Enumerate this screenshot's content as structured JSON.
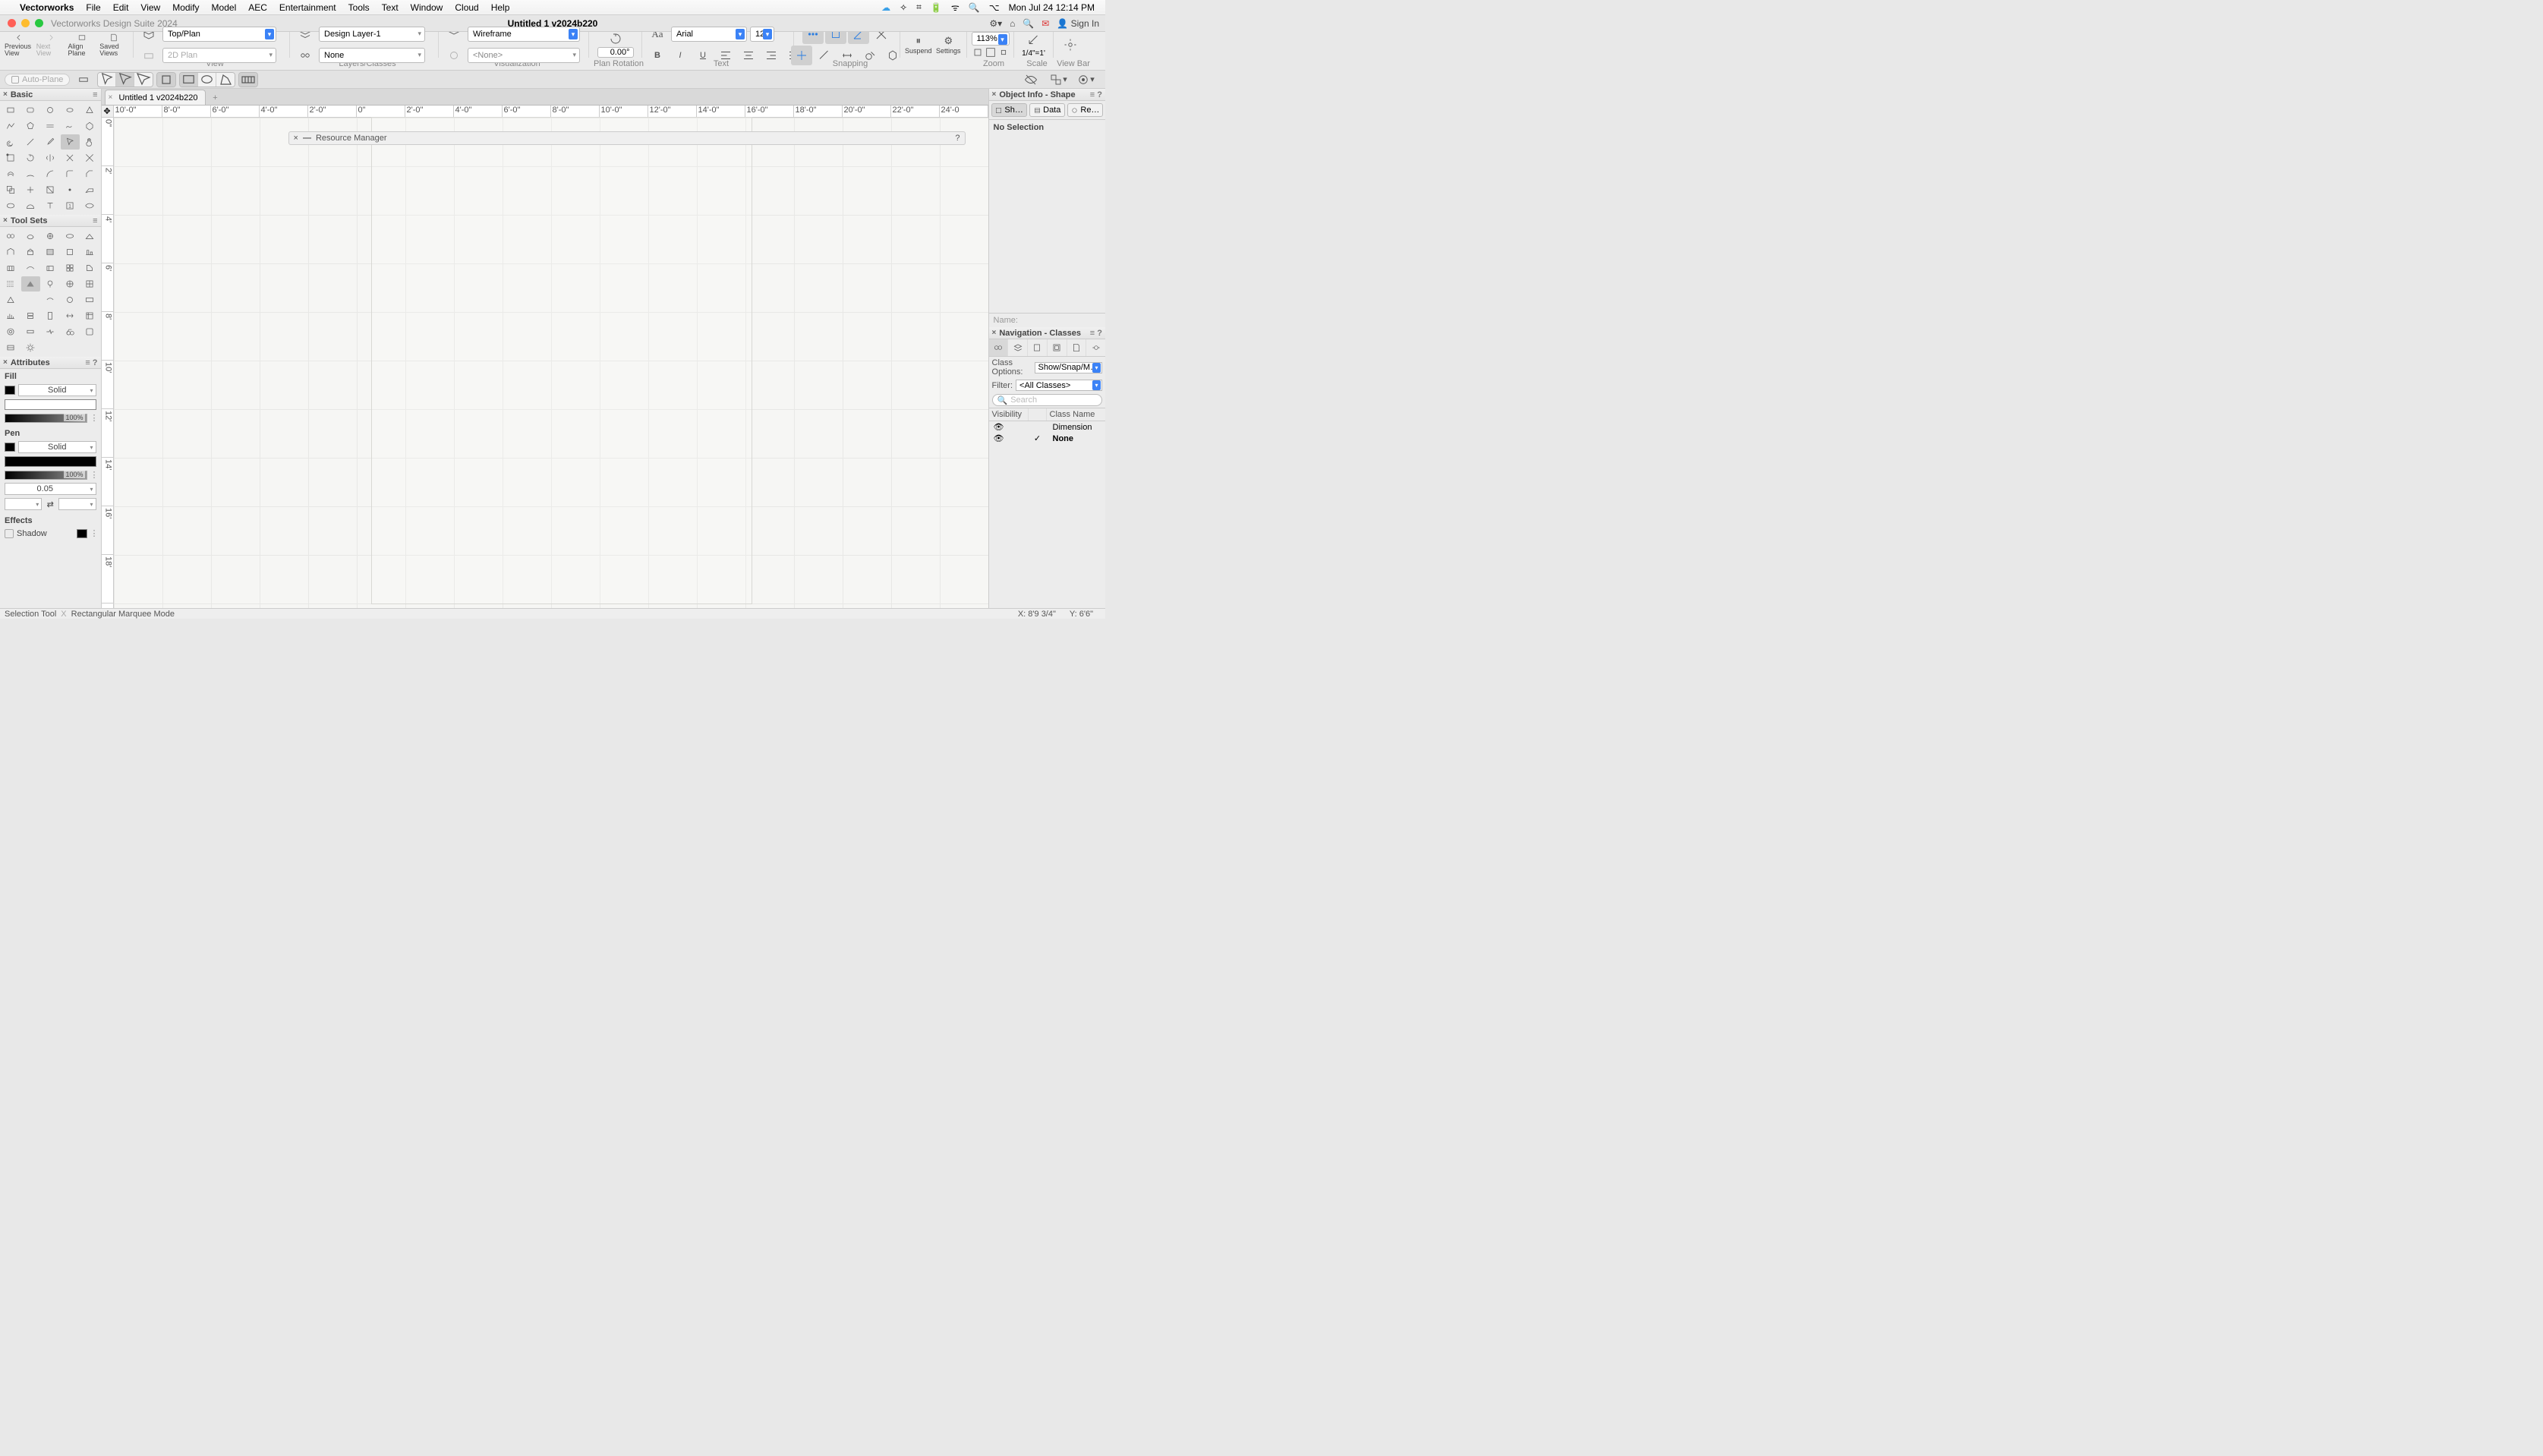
{
  "menubar": {
    "app": "Vectorworks",
    "items": [
      "File",
      "Edit",
      "View",
      "Modify",
      "Model",
      "AEC",
      "Entertainment",
      "Tools",
      "Text",
      "Window",
      "Cloud",
      "Help"
    ],
    "clock": "Mon Jul 24  12:14 PM"
  },
  "titlebar": {
    "window_name": "Vectorworks Design Suite 2024",
    "document": "Untitled 1 v2024b220",
    "sign_in": "Sign In"
  },
  "toolbar": {
    "prev_view": "Previous View",
    "next_view": "Next View",
    "align_plane": "Align Plane",
    "saved_views": "Saved Views",
    "view_sel": "Top/Plan",
    "plane_sel": "2D Plan",
    "layer_sel": "Design Layer-1",
    "class_sel": "None",
    "render_sel": "Wireframe",
    "render2_sel": "<None>",
    "rotation": "0.00°",
    "font": "Arial",
    "font_size": "12",
    "zoom": "113%",
    "scale": "1/4\"=1'",
    "suspend": "Suspend",
    "settings": "Settings",
    "group_labels": {
      "view": "View",
      "layers": "Layers/Classes",
      "viz": "Visualization",
      "rot": "Plan Rotation",
      "text": "Text",
      "snap": "Snapping",
      "zoom": "Zoom",
      "scale": "Scale",
      "viewbar": "View Bar"
    }
  },
  "modebar": {
    "autoplane": "Auto-Plane"
  },
  "palettes": {
    "basic": {
      "title": "Basic"
    },
    "toolsets": {
      "title": "Tool Sets"
    },
    "attributes": {
      "title": "Attributes",
      "fill": "Fill",
      "pen": "Pen",
      "solid": "Solid",
      "opacity": "100%",
      "thickness": "0.05",
      "effects": "Effects",
      "shadow": "Shadow"
    }
  },
  "tabs": {
    "doc": "Untitled 1 v2024b220"
  },
  "ruler_h": [
    "10'-0\"",
    "8'-0\"",
    "6'-0\"",
    "4'-0\"",
    "2'-0\"",
    "0\"",
    "2'-0\"",
    "4'-0\"",
    "6'-0\"",
    "8'-0\"",
    "10'-0\"",
    "12'-0\"",
    "14'-0\"",
    "16'-0\"",
    "18'-0\"",
    "20'-0\"",
    "22'-0\"",
    "24'-0"
  ],
  "ruler_v": [
    "0\"",
    "2'",
    "4'",
    "6'",
    "8'",
    "10'",
    "12'",
    "14'",
    "16'",
    "18'"
  ],
  "resource_manager": {
    "title": "Resource Manager"
  },
  "object_info": {
    "title": "Object Info - Shape",
    "tabs": {
      "shape": "Sh…",
      "data": "Data",
      "render": "Re…"
    },
    "no_sel": "No Selection",
    "name_label": "Name:"
  },
  "navigation": {
    "title": "Navigation - Classes",
    "class_options_label": "Class Options:",
    "class_options_value": "Show/Snap/M…",
    "filter_label": "Filter:",
    "filter_value": "<All Classes>",
    "search_placeholder": "Search",
    "cols": {
      "vis": "Visibility",
      "name": "Class Name"
    },
    "rows": [
      {
        "name": "Dimension",
        "active": false
      },
      {
        "name": "None",
        "active": true
      }
    ]
  },
  "status": {
    "tool": "Selection Tool",
    "mode": "Rectangular Marquee Mode",
    "x_label": "X:",
    "x": "8'9 3/4\"",
    "y_label": "Y:",
    "y": "6'6\""
  }
}
